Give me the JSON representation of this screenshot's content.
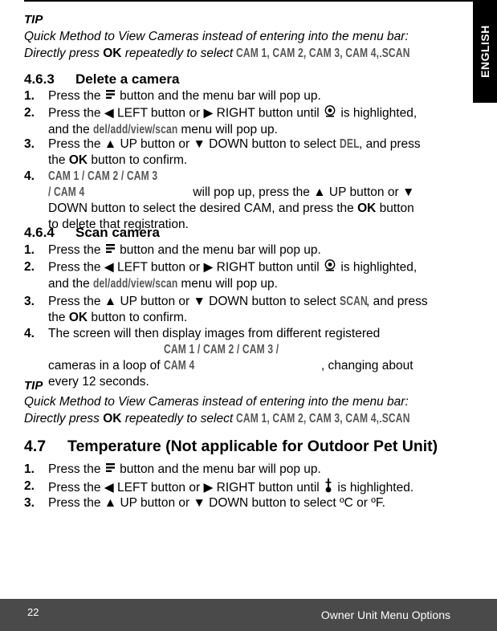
{
  "side_tab": {
    "label": "ENGLISH"
  },
  "tip_top": {
    "title": "TIP",
    "line1": "Quick Method to View Cameras instead of entering into the menu bar:",
    "line2_pre": "Directly press ",
    "line2_ok": "OK",
    "line2_mid": " repeatedly to select ",
    "line2_modes": "CAM 1, CAM 2, CAM 3, CAM 4, SCAN",
    "line2_end": "."
  },
  "section_463": {
    "number": "4.6.3",
    "title": "Delete a camera",
    "steps": [
      {
        "n": "1.",
        "a": "Press the ",
        "b": " button and the menu bar will pop up."
      },
      {
        "n": "2.",
        "a": "Press the ",
        "left": "LEFT button or ",
        "right": "RIGHT button until ",
        "b": " is highlighted,",
        "c": "and the ",
        "menu": "del/add/view/scan",
        "d": " menu will pop up."
      },
      {
        "n": "3.",
        "a": "Press the ",
        "up": "UP button or ",
        "down": "DOWN button to select ",
        "sel": "DEL",
        "b": ", and press",
        "c": "the ",
        "ok": "OK",
        "d": " button to confirm."
      },
      {
        "n": "4.",
        "cams": "CAM 1 / CAM 2 / CAM 3 / CAM 4",
        "a": " will pop up, press the ",
        "up": "UP button or ",
        "b": "DOWN button to select the desired CAM, and press the ",
        "ok": "OK",
        "c": " button",
        "d": "to delete that registration."
      }
    ]
  },
  "section_464": {
    "number": "4.6.4",
    "title": "Scan camera",
    "steps": [
      {
        "n": "1.",
        "a": "Press the ",
        "b": " button and the menu bar will pop up."
      },
      {
        "n": "2.",
        "a": "Press the ",
        "left": "LEFT button or ",
        "right": "RIGHT button until ",
        "b": " is highlighted,",
        "c": "and the ",
        "menu": "del/add/view/scan",
        "d": " menu will pop up."
      },
      {
        "n": "3.",
        "a": "Press the ",
        "up": "UP button or ",
        "down": "DOWN button to select ",
        "sel": "SCAN",
        "b": ", and press",
        "c": "the ",
        "ok": "OK",
        "d": " button to confirm."
      },
      {
        "n": "4.",
        "a": "The screen will then display images from different registered",
        "b": "cameras in a loop of ",
        "cams": "CAM 1 / CAM 2 / CAM 3 / CAM 4",
        "c": ", changing about",
        "d": "every 12 seconds."
      }
    ]
  },
  "tip_bottom": {
    "title": "TIP",
    "line1": "Quick Method to View Cameras instead of entering into the menu bar:",
    "line2_pre": "Directly press ",
    "line2_ok": "OK",
    "line2_mid": " repeatedly to select ",
    "line2_modes": "CAM 1, CAM 2, CAM 3, CAM 4, SCAN",
    "line2_end": "."
  },
  "section_47": {
    "number": "4.7",
    "title": "Temperature (Not applicable for Outdoor Pet Unit)",
    "steps": [
      {
        "n": "1.",
        "a": "Press the ",
        "b": " button and the menu bar will pop up."
      },
      {
        "n": "2.",
        "a": "Press the ",
        "left": "LEFT button or ",
        "right": "RIGHT button until ",
        "b": " is highlighted."
      },
      {
        "n": "3.",
        "a": "Press the ",
        "up": "UP button or ",
        "down": "DOWN button to select ºC or ºF."
      }
    ]
  },
  "footer": {
    "page_number": "22",
    "section": "Owner Unit Menu Options"
  },
  "icons": {
    "menu": "menu-icon",
    "left": "◀",
    "right": "▶",
    "up": "▲",
    "down": "▼",
    "camera": "camera-icon",
    "thermometer": "thermometer-icon"
  }
}
